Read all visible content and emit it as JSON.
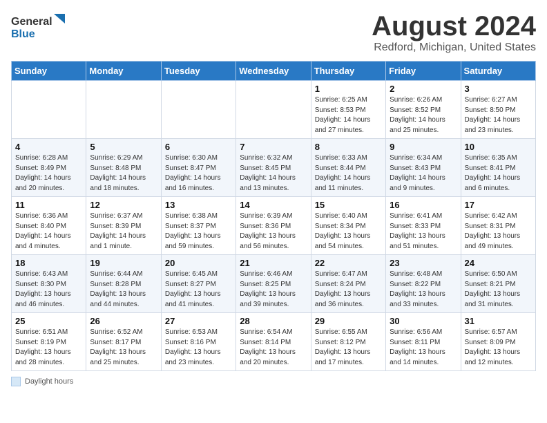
{
  "header": {
    "logo_line1": "General",
    "logo_line2": "Blue",
    "month": "August 2024",
    "location": "Redford, Michigan, United States"
  },
  "weekdays": [
    "Sunday",
    "Monday",
    "Tuesday",
    "Wednesday",
    "Thursday",
    "Friday",
    "Saturday"
  ],
  "weeks": [
    [
      {
        "day": "",
        "sunrise": "",
        "sunset": "",
        "daylight": ""
      },
      {
        "day": "",
        "sunrise": "",
        "sunset": "",
        "daylight": ""
      },
      {
        "day": "",
        "sunrise": "",
        "sunset": "",
        "daylight": ""
      },
      {
        "day": "",
        "sunrise": "",
        "sunset": "",
        "daylight": ""
      },
      {
        "day": "1",
        "sunrise": "Sunrise: 6:25 AM",
        "sunset": "Sunset: 8:53 PM",
        "daylight": "Daylight: 14 hours and 27 minutes."
      },
      {
        "day": "2",
        "sunrise": "Sunrise: 6:26 AM",
        "sunset": "Sunset: 8:52 PM",
        "daylight": "Daylight: 14 hours and 25 minutes."
      },
      {
        "day": "3",
        "sunrise": "Sunrise: 6:27 AM",
        "sunset": "Sunset: 8:50 PM",
        "daylight": "Daylight: 14 hours and 23 minutes."
      }
    ],
    [
      {
        "day": "4",
        "sunrise": "Sunrise: 6:28 AM",
        "sunset": "Sunset: 8:49 PM",
        "daylight": "Daylight: 14 hours and 20 minutes."
      },
      {
        "day": "5",
        "sunrise": "Sunrise: 6:29 AM",
        "sunset": "Sunset: 8:48 PM",
        "daylight": "Daylight: 14 hours and 18 minutes."
      },
      {
        "day": "6",
        "sunrise": "Sunrise: 6:30 AM",
        "sunset": "Sunset: 8:47 PM",
        "daylight": "Daylight: 14 hours and 16 minutes."
      },
      {
        "day": "7",
        "sunrise": "Sunrise: 6:32 AM",
        "sunset": "Sunset: 8:45 PM",
        "daylight": "Daylight: 14 hours and 13 minutes."
      },
      {
        "day": "8",
        "sunrise": "Sunrise: 6:33 AM",
        "sunset": "Sunset: 8:44 PM",
        "daylight": "Daylight: 14 hours and 11 minutes."
      },
      {
        "day": "9",
        "sunrise": "Sunrise: 6:34 AM",
        "sunset": "Sunset: 8:43 PM",
        "daylight": "Daylight: 14 hours and 9 minutes."
      },
      {
        "day": "10",
        "sunrise": "Sunrise: 6:35 AM",
        "sunset": "Sunset: 8:41 PM",
        "daylight": "Daylight: 14 hours and 6 minutes."
      }
    ],
    [
      {
        "day": "11",
        "sunrise": "Sunrise: 6:36 AM",
        "sunset": "Sunset: 8:40 PM",
        "daylight": "Daylight: 14 hours and 4 minutes."
      },
      {
        "day": "12",
        "sunrise": "Sunrise: 6:37 AM",
        "sunset": "Sunset: 8:39 PM",
        "daylight": "Daylight: 14 hours and 1 minute."
      },
      {
        "day": "13",
        "sunrise": "Sunrise: 6:38 AM",
        "sunset": "Sunset: 8:37 PM",
        "daylight": "Daylight: 13 hours and 59 minutes."
      },
      {
        "day": "14",
        "sunrise": "Sunrise: 6:39 AM",
        "sunset": "Sunset: 8:36 PM",
        "daylight": "Daylight: 13 hours and 56 minutes."
      },
      {
        "day": "15",
        "sunrise": "Sunrise: 6:40 AM",
        "sunset": "Sunset: 8:34 PM",
        "daylight": "Daylight: 13 hours and 54 minutes."
      },
      {
        "day": "16",
        "sunrise": "Sunrise: 6:41 AM",
        "sunset": "Sunset: 8:33 PM",
        "daylight": "Daylight: 13 hours and 51 minutes."
      },
      {
        "day": "17",
        "sunrise": "Sunrise: 6:42 AM",
        "sunset": "Sunset: 8:31 PM",
        "daylight": "Daylight: 13 hours and 49 minutes."
      }
    ],
    [
      {
        "day": "18",
        "sunrise": "Sunrise: 6:43 AM",
        "sunset": "Sunset: 8:30 PM",
        "daylight": "Daylight: 13 hours and 46 minutes."
      },
      {
        "day": "19",
        "sunrise": "Sunrise: 6:44 AM",
        "sunset": "Sunset: 8:28 PM",
        "daylight": "Daylight: 13 hours and 44 minutes."
      },
      {
        "day": "20",
        "sunrise": "Sunrise: 6:45 AM",
        "sunset": "Sunset: 8:27 PM",
        "daylight": "Daylight: 13 hours and 41 minutes."
      },
      {
        "day": "21",
        "sunrise": "Sunrise: 6:46 AM",
        "sunset": "Sunset: 8:25 PM",
        "daylight": "Daylight: 13 hours and 39 minutes."
      },
      {
        "day": "22",
        "sunrise": "Sunrise: 6:47 AM",
        "sunset": "Sunset: 8:24 PM",
        "daylight": "Daylight: 13 hours and 36 minutes."
      },
      {
        "day": "23",
        "sunrise": "Sunrise: 6:48 AM",
        "sunset": "Sunset: 8:22 PM",
        "daylight": "Daylight: 13 hours and 33 minutes."
      },
      {
        "day": "24",
        "sunrise": "Sunrise: 6:50 AM",
        "sunset": "Sunset: 8:21 PM",
        "daylight": "Daylight: 13 hours and 31 minutes."
      }
    ],
    [
      {
        "day": "25",
        "sunrise": "Sunrise: 6:51 AM",
        "sunset": "Sunset: 8:19 PM",
        "daylight": "Daylight: 13 hours and 28 minutes."
      },
      {
        "day": "26",
        "sunrise": "Sunrise: 6:52 AM",
        "sunset": "Sunset: 8:17 PM",
        "daylight": "Daylight: 13 hours and 25 minutes."
      },
      {
        "day": "27",
        "sunrise": "Sunrise: 6:53 AM",
        "sunset": "Sunset: 8:16 PM",
        "daylight": "Daylight: 13 hours and 23 minutes."
      },
      {
        "day": "28",
        "sunrise": "Sunrise: 6:54 AM",
        "sunset": "Sunset: 8:14 PM",
        "daylight": "Daylight: 13 hours and 20 minutes."
      },
      {
        "day": "29",
        "sunrise": "Sunrise: 6:55 AM",
        "sunset": "Sunset: 8:12 PM",
        "daylight": "Daylight: 13 hours and 17 minutes."
      },
      {
        "day": "30",
        "sunrise": "Sunrise: 6:56 AM",
        "sunset": "Sunset: 8:11 PM",
        "daylight": "Daylight: 13 hours and 14 minutes."
      },
      {
        "day": "31",
        "sunrise": "Sunrise: 6:57 AM",
        "sunset": "Sunset: 8:09 PM",
        "daylight": "Daylight: 13 hours and 12 minutes."
      }
    ]
  ],
  "legend": {
    "box_label": "Daylight hours"
  }
}
